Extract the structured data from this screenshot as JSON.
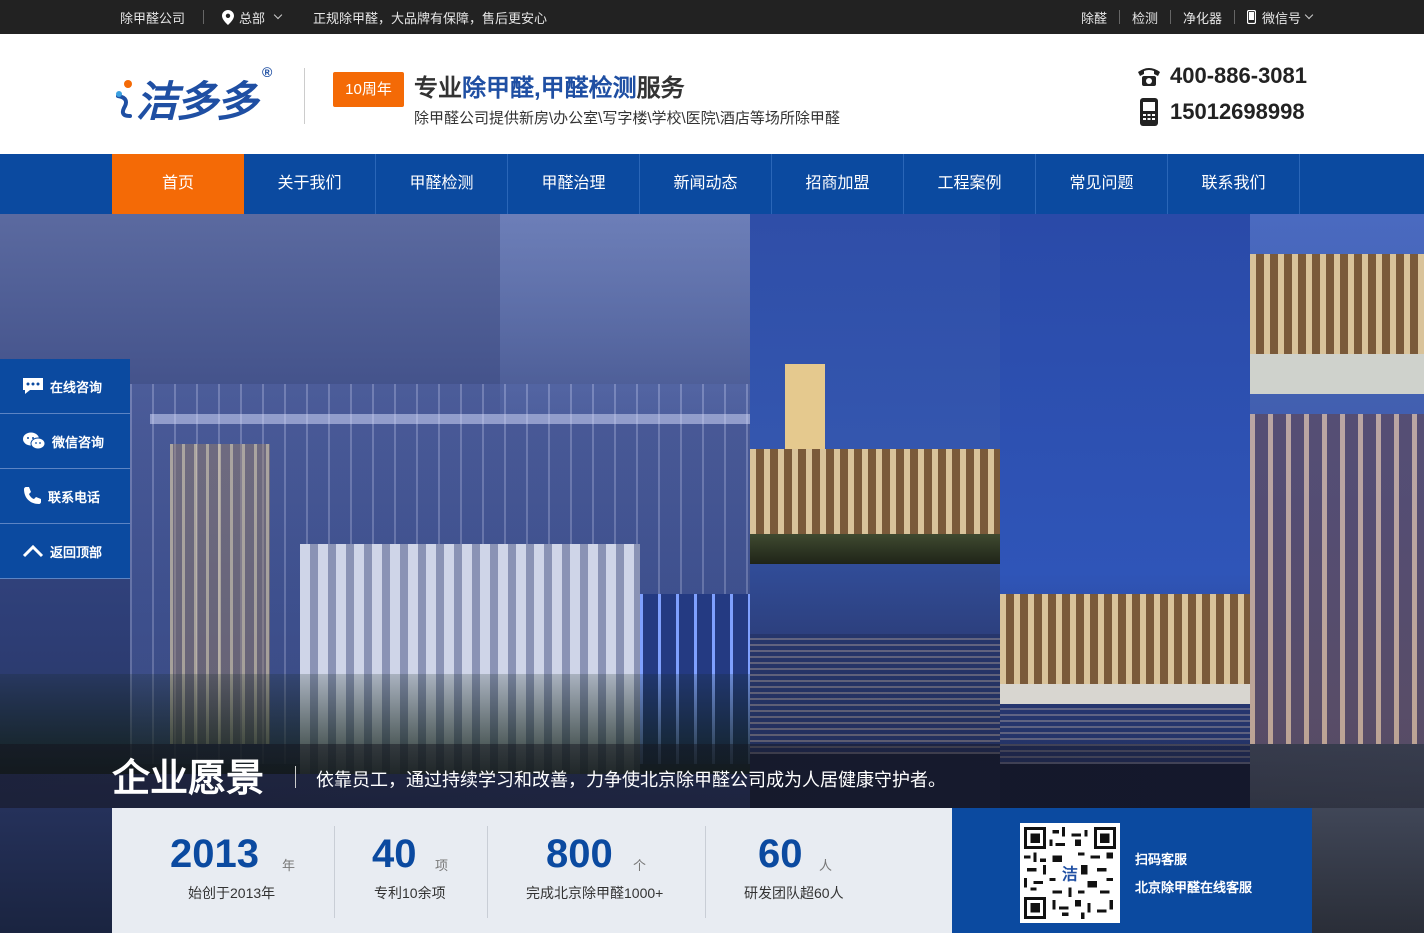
{
  "topbar": {
    "company": "除甲醛公司",
    "location": "总部",
    "tagline": "正规除甲醛，大品牌有保障，售后更安心",
    "links": [
      "除醛",
      "检测",
      "净化器"
    ],
    "wechat": "微信号"
  },
  "header": {
    "logo_text": "洁多多",
    "logo_reg": "®",
    "badge": "10周年",
    "slogan_a": "专业",
    "slogan_b": "除甲醛,甲醛检测",
    "slogan_c": "服务",
    "sub_slogan": "除甲醛公司提供新房\\办公室\\写字楼\\学校\\医院\\酒店等场所除甲醛",
    "phone1": "400-886-3081",
    "phone2": "15012698998"
  },
  "nav": [
    "首页",
    "关于我们",
    "甲醛检测",
    "甲醛治理",
    "新闻动态",
    "招商加盟",
    "工程案例",
    "常见问题",
    "联系我们"
  ],
  "side": [
    "在线咨询",
    "微信咨询",
    "联系电话",
    "返回顶部"
  ],
  "vision": {
    "title": "企业愿景",
    "text": "依靠员工，通过持续学习和改善，力争使北京除甲醛公司成为人居健康守护者。"
  },
  "stats": [
    {
      "num": "2013",
      "unit": "年",
      "label": "始创于2013年"
    },
    {
      "num": "40",
      "unit": "项",
      "label": "专利10余项"
    },
    {
      "num": "800",
      "unit": "个",
      "label": "完成北京除甲醛1000+"
    },
    {
      "num": "60",
      "unit": "人",
      "label": "研发团队超60人"
    }
  ],
  "qr": {
    "line1": "扫码客服",
    "line2": "北京除甲醛在线客服"
  },
  "colors": {
    "brand_blue": "#0b4aa0",
    "accent_orange": "#f46a06",
    "topbar": "#222222"
  }
}
